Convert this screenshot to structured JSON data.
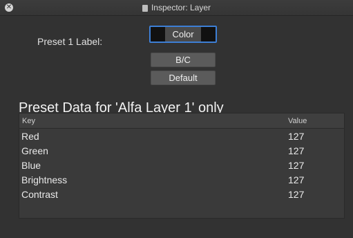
{
  "window": {
    "title": "Inspector: Layer"
  },
  "preset": {
    "label": "Preset 1 Label:",
    "options": [
      {
        "label": "Color",
        "active": true
      },
      {
        "label": "B/C",
        "active": false
      },
      {
        "label": "Default",
        "active": false
      }
    ]
  },
  "section": {
    "title": "Preset Data for 'Alfa Layer 1' only"
  },
  "table": {
    "headers": {
      "key": "Key",
      "value": "Value"
    },
    "rows": [
      {
        "key": "Red",
        "value": "127"
      },
      {
        "key": "Green",
        "value": "127"
      },
      {
        "key": "Blue",
        "value": "127"
      },
      {
        "key": "Brightness",
        "value": "127"
      },
      {
        "key": "Contrast",
        "value": "127"
      }
    ]
  },
  "icons": {
    "close": "close-icon",
    "document": "document-icon"
  },
  "colors": {
    "accent": "#3d7fd6"
  }
}
